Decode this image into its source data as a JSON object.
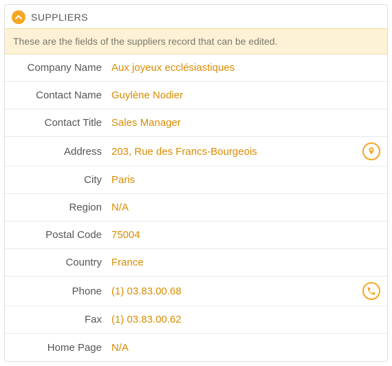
{
  "header": {
    "title": "SUPPLIERS"
  },
  "description": "These are the fields of the suppliers record that can be edited.",
  "fields": {
    "company_name": {
      "label": "Company Name",
      "value": "Aux joyeux ecclésiastiques"
    },
    "contact_name": {
      "label": "Contact Name",
      "value": "Guylène Nodier"
    },
    "contact_title": {
      "label": "Contact Title",
      "value": "Sales Manager"
    },
    "address": {
      "label": "Address",
      "value": "203, Rue des Francs-Bourgeois"
    },
    "city": {
      "label": "City",
      "value": "Paris"
    },
    "region": {
      "label": "Region",
      "value": "N/A"
    },
    "postal_code": {
      "label": "Postal Code",
      "value": "75004"
    },
    "country": {
      "label": "Country",
      "value": "France"
    },
    "phone": {
      "label": "Phone",
      "value": "(1) 03.83.00.68"
    },
    "fax": {
      "label": "Fax",
      "value": "(1) 03.83.00.62"
    },
    "home_page": {
      "label": "Home Page",
      "value": "N/A"
    }
  },
  "colors": {
    "accent": "#f5a623",
    "value_text": "#d98c00"
  }
}
